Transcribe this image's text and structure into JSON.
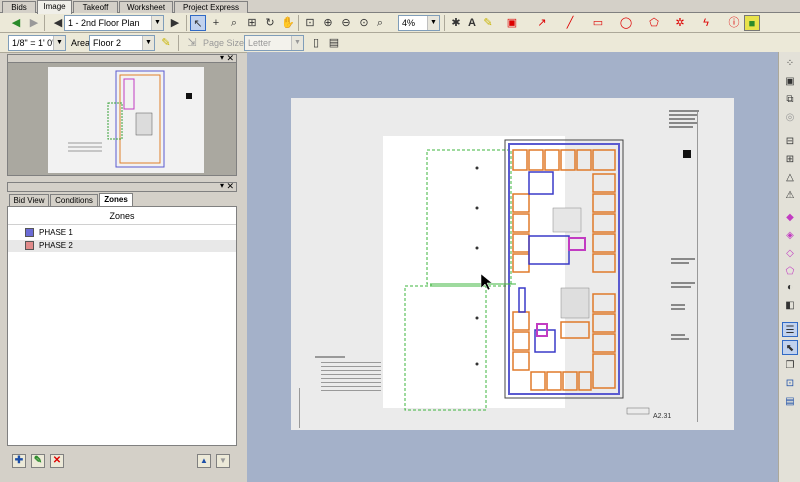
{
  "tabs": [
    "Bids",
    "Image",
    "Takeoff",
    "Worksheet",
    "Project Express"
  ],
  "toolbar1": {
    "page_select": "1 - 2nd Floor Plan",
    "zoom_value": "4%"
  },
  "toolbar2": {
    "scale_select": "1/8\" = 1' 0\"",
    "area_label": "Area",
    "area_select": "Floor 2",
    "page_size_label": "Page Size",
    "page_size_select": "Letter"
  },
  "left_panel": {
    "subtabs": [
      "Bid View",
      "Conditions",
      "Zones"
    ],
    "zones_header": "Zones",
    "zones": [
      {
        "name": "PHASE 1",
        "color": "#6b6bd6"
      },
      {
        "name": "PHASE 2",
        "color": "#e08a8a"
      }
    ]
  },
  "sheet": {
    "sheet_number": "A2.31"
  },
  "colors": {
    "canvas_bg": "#a4b1c9",
    "toolbar_bg": "#ece9d8",
    "accent_blue": "#316ac5"
  }
}
